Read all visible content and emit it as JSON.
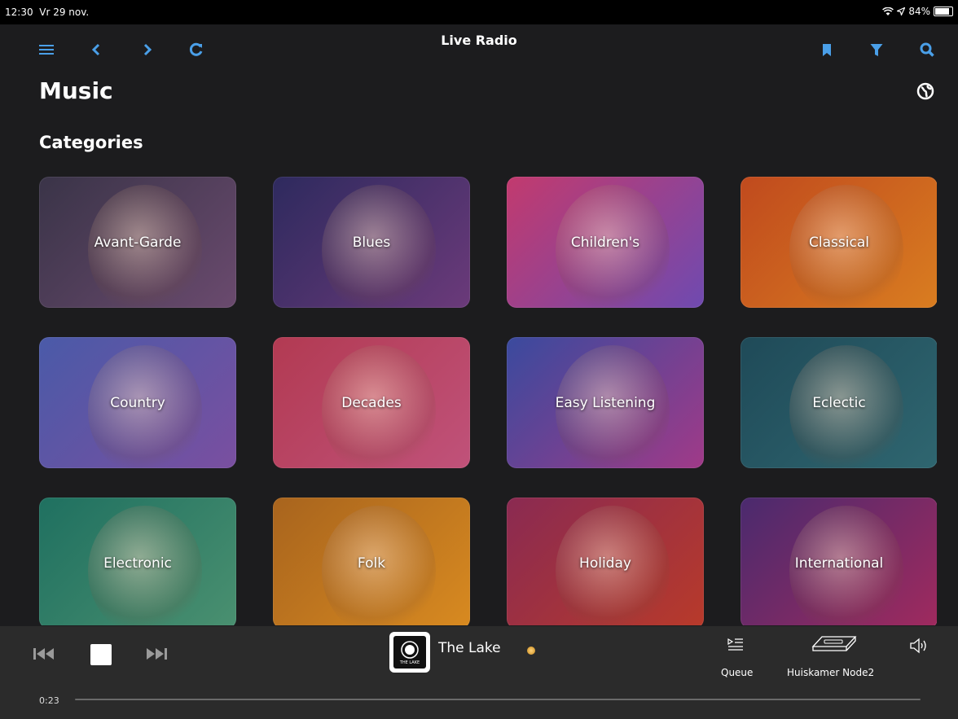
{
  "status_bar": {
    "time": "12:30",
    "date": "Vr 29 nov.",
    "battery": "84%",
    "battery_level": 0.84
  },
  "navbar": {
    "title": "Live Radio",
    "accent_color": "#4a9fe8",
    "left_icons": [
      "menu-icon",
      "back-icon",
      "forward-icon",
      "refresh-icon"
    ],
    "right_icons": [
      "bookmark-icon",
      "filter-icon",
      "search-icon"
    ]
  },
  "page": {
    "title": "Music",
    "section_title": "Categories"
  },
  "categories": [
    {
      "label": "Avant-Garde",
      "colors": [
        "#3a3448",
        "#6a4a6e"
      ]
    },
    {
      "label": "Blues",
      "colors": [
        "#2e2a5e",
        "#6b3a7a"
      ]
    },
    {
      "label": "Children's",
      "colors": [
        "#c23a6e",
        "#6f4ab0"
      ]
    },
    {
      "label": "Classical",
      "colors": [
        "#c04a1e",
        "#d97d20"
      ]
    },
    {
      "label": "Country",
      "colors": [
        "#4a5aa8",
        "#7a4fa0"
      ]
    },
    {
      "label": "Decades",
      "colors": [
        "#b23a52",
        "#c0527a"
      ]
    },
    {
      "label": "Easy Listening",
      "colors": [
        "#3a4a9e",
        "#a03a88"
      ]
    },
    {
      "label": "Eclectic",
      "colors": [
        "#1f4a58",
        "#2f6670"
      ]
    },
    {
      "label": "Electronic",
      "colors": [
        "#1f7060",
        "#4a9070"
      ]
    },
    {
      "label": "Folk",
      "colors": [
        "#a8641e",
        "#d88a20"
      ]
    },
    {
      "label": "Holiday",
      "colors": [
        "#8a2a52",
        "#b83a2a"
      ]
    },
    {
      "label": "International",
      "colors": [
        "#4a2a6e",
        "#a02a5e"
      ]
    }
  ],
  "player": {
    "station": "The Lake",
    "artwork_text": "THE LAKE",
    "queue_label": "Queue",
    "device_label": "Huiskamer Node2",
    "elapsed": "0:23",
    "progress": 0.0
  }
}
